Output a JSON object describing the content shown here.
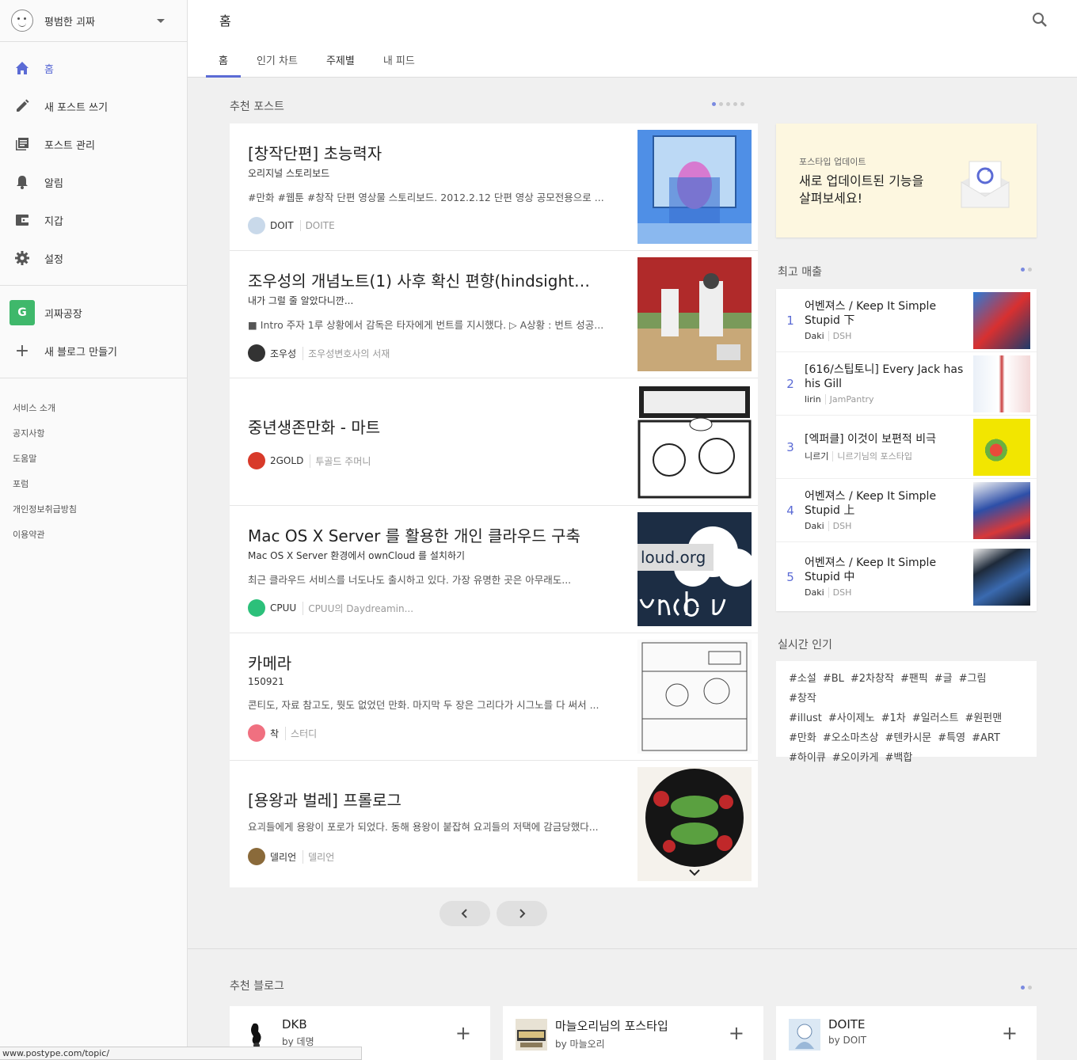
{
  "user": {
    "name": "평범한 괴짜"
  },
  "nav": [
    {
      "label": "홈",
      "icon": "home-icon",
      "active": true
    },
    {
      "label": "새 포스트 쓰기",
      "icon": "pencil-icon"
    },
    {
      "label": "포스트 관리",
      "icon": "posts-manage-icon"
    },
    {
      "label": "알림",
      "icon": "bell-icon"
    },
    {
      "label": "지갑",
      "icon": "wallet-icon"
    },
    {
      "label": "설정",
      "icon": "gear-icon"
    }
  ],
  "blogs": {
    "mine": "괴짜공장",
    "mine_badge": "G",
    "new": "새 블로그 만들기"
  },
  "footer_links": [
    "서비스 소개",
    "공지사항",
    "도움말",
    "포럼",
    "개인정보취급방침",
    "이용약관"
  ],
  "header": {
    "title": "홈",
    "tabs": [
      "홈",
      "인기 차트",
      "주제별",
      "내 피드"
    ]
  },
  "recommended_posts": {
    "title": "추천 포스트",
    "items": [
      {
        "title": "[창작단편] 초능력자",
        "subtitle": "오리지널 스토리보드",
        "desc": "#만화 #웹툰 #창작 단편 영상물 스토리보드. 2012.2.12 단편 영상 공모전용으로 ...",
        "author": "DOIT",
        "blog": "DOITE"
      },
      {
        "title": "조우성의 개념노트(1) 사후 확신 편향(hindsight…",
        "subtitle": "내가 그럴 줄 알았다니깐...",
        "desc": "■ Intro 주자 1루 상황에서 감독은 타자에게 번트를 지시했다. ▷ A상황 : 번트 성공...",
        "author": "조우성",
        "blog": "조우성변호사의 서재"
      },
      {
        "title": "중년생존만화 - 마트",
        "subtitle": "",
        "desc": "",
        "author": "2GOLD",
        "blog": "투골드 주머니"
      },
      {
        "title": "Mac OS X Server 를 활용한 개인 클라우드 구축",
        "subtitle": "Mac OS X Server 환경에서 ownCloud 를 설치하기",
        "desc": "최근 클라우드 서비스를 너도나도 출시하고 있다. 가장 유명한 곳은 아무래도...",
        "author": "CPUU",
        "blog": "CPUU의 Daydreamin..."
      },
      {
        "title": "카메라",
        "subtitle": "150921",
        "desc": "콘티도, 자료 참고도, 뭣도 없었던 만화. 마지막 두 장은 그리다가 시그노를 다 써서 ...",
        "author": "착",
        "blog": "스터디"
      },
      {
        "title": "[용왕과 벌레] 프롤로그",
        "subtitle": "",
        "desc": "요괴들에게 용왕이 포로가 되었다. 동해 용왕이 붙잡혀 요괴들의 저택에 감금당했다...",
        "author": "델리언",
        "blog": "델리언"
      }
    ]
  },
  "update": {
    "small": "포스타입 업데이트",
    "big": "새로 업데이트된 기능을 살펴보세요!"
  },
  "best_sales": {
    "title": "최고 매출",
    "items": [
      {
        "rank": "1",
        "title": "어벤져스 / Keep It Simple Stupid 下",
        "author": "Daki",
        "blog": "DSH"
      },
      {
        "rank": "2",
        "title": "[616/스팁토니] Every Jack has his Gill",
        "author": "lirin",
        "blog": "JamPantry"
      },
      {
        "rank": "3",
        "title": "[엑퍼클] 이것이 보편적 비극",
        "author": "니르기",
        "blog": "니르기님의 포스타입"
      },
      {
        "rank": "4",
        "title": "어벤져스 / Keep It Simple Stupid 上",
        "author": "Daki",
        "blog": "DSH"
      },
      {
        "rank": "5",
        "title": "어벤져스 / Keep It Simple Stupid 中",
        "author": "Daki",
        "blog": "DSH"
      }
    ]
  },
  "realtime": {
    "title": "실시간 인기",
    "tags": [
      "#소설",
      "#BL",
      "#2차창작",
      "#팬픽",
      "#글",
      "#그림",
      "#창작",
      "#illust",
      "#사이제노",
      "#1차",
      "#일러스트",
      "#원펀맨",
      "#만화",
      "#오소마츠상",
      "#텐카시문",
      "#특영",
      "#ART",
      "#하이큐",
      "#오이카게",
      "#백합"
    ]
  },
  "recommended_blogs": {
    "title": "추천 블로그",
    "items": [
      {
        "name": "DKB",
        "by": "by 데명"
      },
      {
        "name": "마늘오리님의 포스타입",
        "by": "by 마늘오리"
      },
      {
        "name": "DOITE",
        "by": "by DOIT"
      }
    ]
  },
  "status_url": "www.postype.com/topic/",
  "colors": {
    "accent": "#5b6bd5",
    "sidebar_bg": "#fafafa",
    "main_bg": "#f0f0f0",
    "update_bg": "#fdf7e0"
  }
}
